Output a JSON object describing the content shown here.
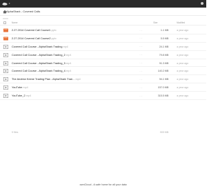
{
  "breadcrumb": {
    "current": "AlphaShark - Covered Calls"
  },
  "headers": {
    "name": "Name",
    "size": "Size",
    "modified": "Modified"
  },
  "files": [
    {
      "name": "2.27.2014 Covered Call Course1",
      "ext": ".pptx",
      "size": "1.1 MB",
      "modified": "a year ago",
      "type": "presentation"
    },
    {
      "name": "2.27.2014 Covered Call Course2",
      "ext": ".pptx",
      "size": "5.5 MB",
      "modified": "a year ago",
      "type": "presentation"
    },
    {
      "name": "Covered Call Course - AlphaShark Trading",
      "ext": ".mp4",
      "size": "24.1 MB",
      "modified": "a year ago",
      "type": "video"
    },
    {
      "name": "Covered Call Course - AlphaShark Trading_2",
      "ext": ".mp4",
      "size": "79.8 MB",
      "modified": "a year ago",
      "type": "video"
    },
    {
      "name": "Covered Call Course - AlphaShark Trading_3",
      "ext": ".mp4",
      "size": "91.3 MB",
      "modified": "a year ago",
      "type": "video"
    },
    {
      "name": "Covered Call Course - AlphaShark Trading_4",
      "ext": ".mp4",
      "size": "140.2 MB",
      "modified": "a year ago",
      "type": "video"
    },
    {
      "name": "The Andrew Keene Trading Plan - AlphaShark Trad...",
      "ext": ".mp4",
      "size": "94.1 MB",
      "modified": "a year ago",
      "type": "video"
    },
    {
      "name": "YouTube",
      "ext": ".mp4",
      "size": "157.0 MB",
      "modified": "a year ago",
      "type": "video"
    },
    {
      "name": "YouTube_2",
      "ext": ".mp4",
      "size": "315.5 MB",
      "modified": "a year ago",
      "type": "video"
    }
  ],
  "summary": {
    "count": "9 files",
    "total": "909 MB"
  },
  "footer": {
    "text": "ownCloud - A safe home for all your data"
  },
  "colors": {
    "topbar": "#2a2a2a",
    "folder_orange": "#e8743b",
    "video_gray": "#8a8a8a"
  }
}
